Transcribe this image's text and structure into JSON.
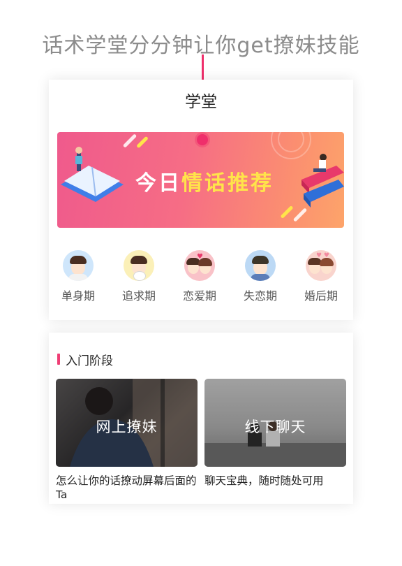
{
  "headline": "话术学堂分分钟让你get撩妹技能",
  "card": {
    "title": "学堂",
    "banner": {
      "text_prefix": "今日",
      "text_highlight": "情话推荐"
    },
    "categories": [
      {
        "label": "单身期",
        "icon": "single-boy-icon",
        "bg": "#cfe6fb"
      },
      {
        "label": "追求期",
        "icon": "pursuit-boy-flowers-icon",
        "bg": "#fbf0b8"
      },
      {
        "label": "恋爱期",
        "icon": "love-couple-icon",
        "bg": "#f9c2c8"
      },
      {
        "label": "失恋期",
        "icon": "heartbroken-boy-icon",
        "bg": "#bcd9f5"
      },
      {
        "label": "婚后期",
        "icon": "married-couple-icon",
        "bg": "#f9d4cd"
      }
    ]
  },
  "section": {
    "title": "入门阶段",
    "items": [
      {
        "tile_label": "网上撩妹",
        "description": "怎么让你的话撩动屏幕后面的Ta"
      },
      {
        "tile_label": "线下聊天",
        "description": "聊天宝典，随时随处可用"
      }
    ]
  },
  "colors": {
    "accent": "#ef2f6b",
    "banner_from": "#ef5a8c",
    "banner_to": "#fda46a"
  }
}
